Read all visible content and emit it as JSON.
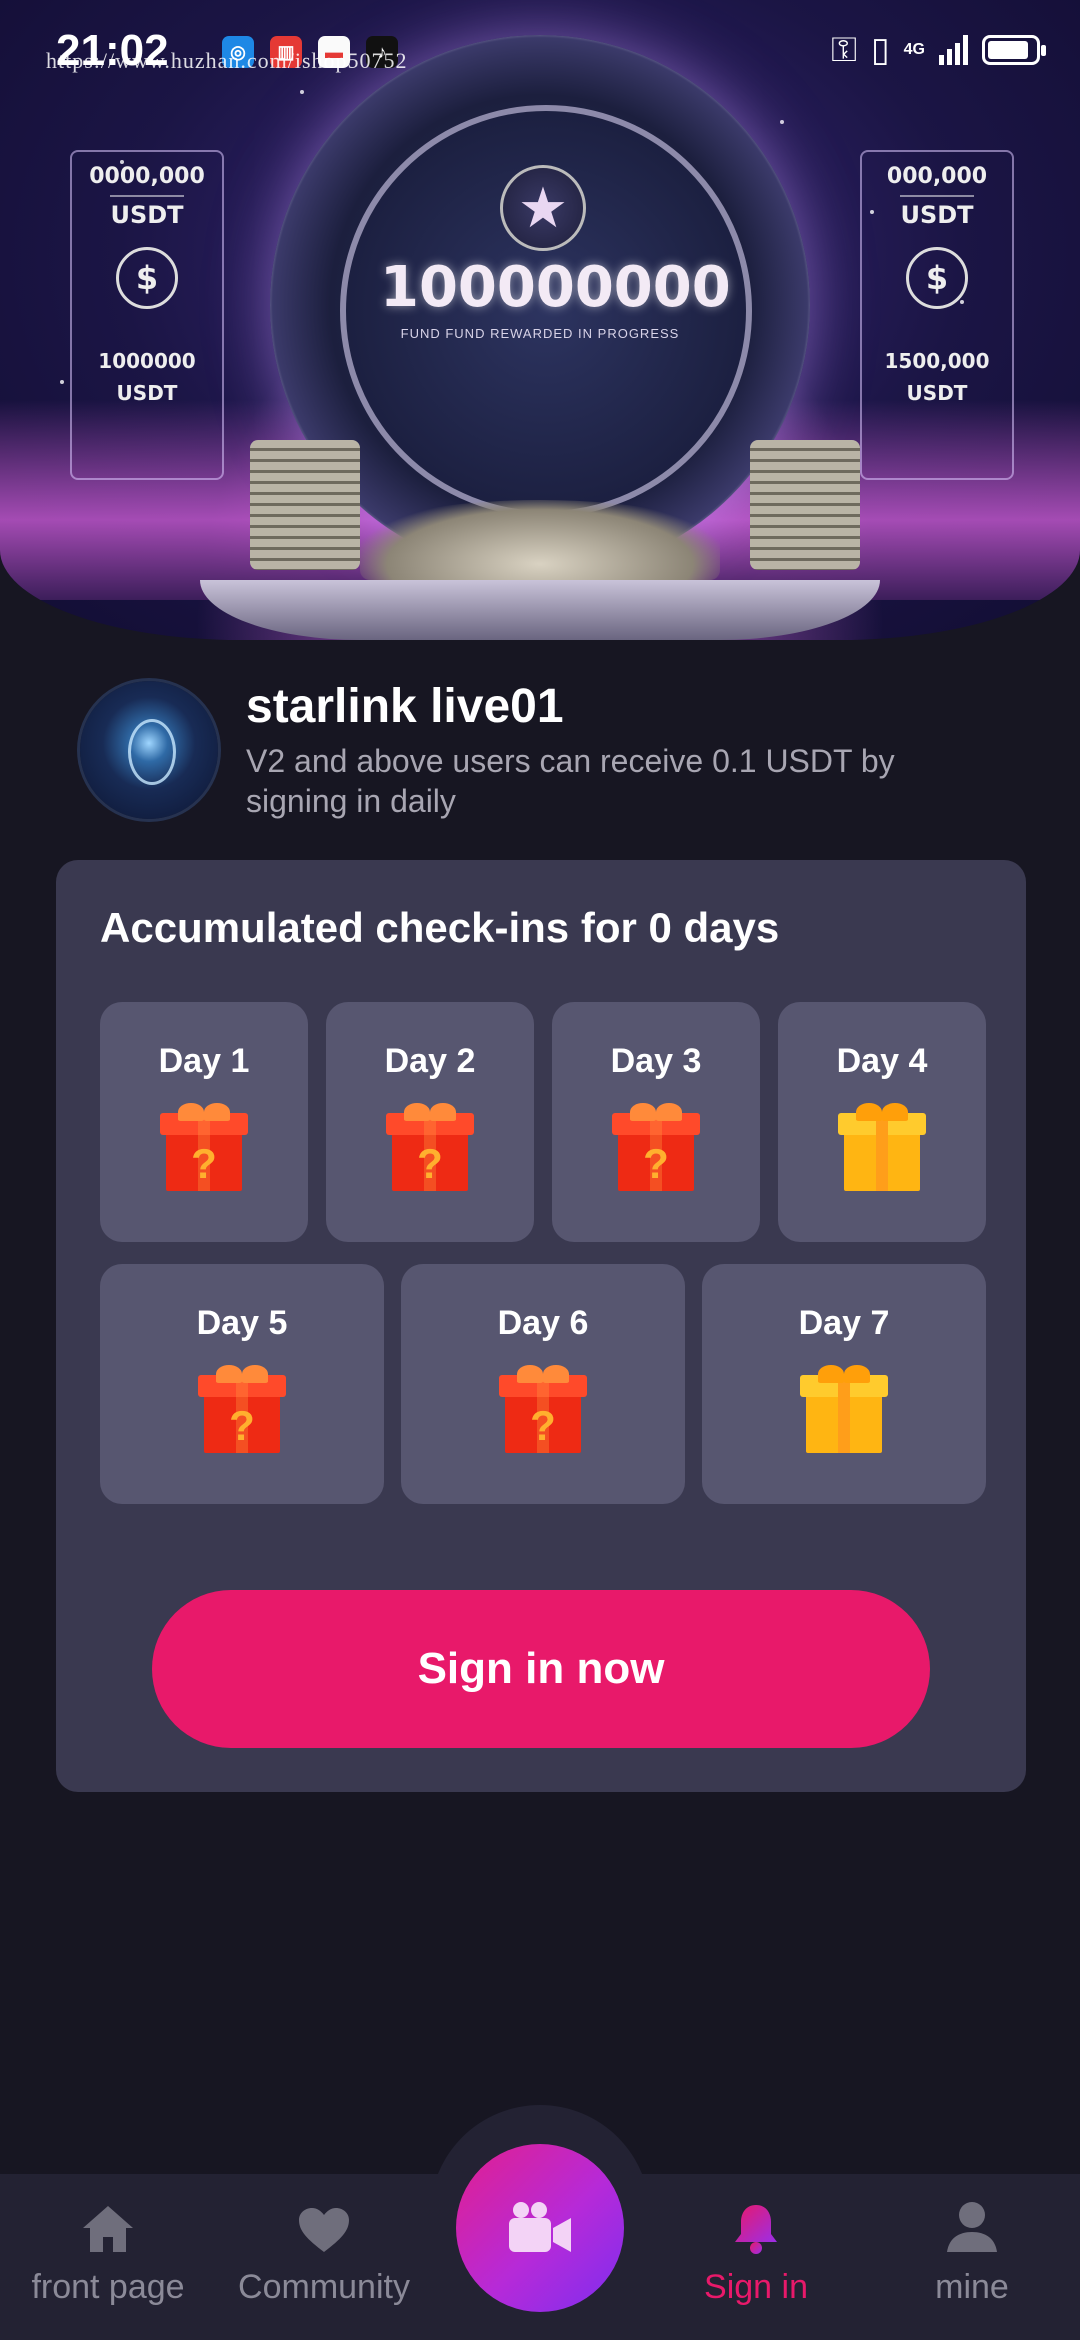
{
  "status_bar": {
    "time": "21:02",
    "network": "4G",
    "apps": [
      "browser-icon",
      "app-red-icon",
      "app-white-icon",
      "tiktok-icon"
    ],
    "watermark": "https://www.huzhan.com/ishop50752"
  },
  "banner": {
    "big_number": "100000000",
    "tagline": "FUND FUND REWARDED IN PROGRESS",
    "left_panel": {
      "amount": "0000,000",
      "unit": "USDT",
      "amount2": "1000000",
      "unit2": "USDT"
    },
    "right_panel": {
      "amount": "000,000",
      "unit": "USDT",
      "amount2": "1500,000",
      "unit2": "USDT"
    },
    "colors": {
      "top": "#120d33",
      "glow": "#d06ad9"
    }
  },
  "profile": {
    "name": "starlink live01",
    "description": "V2 and above users can receive 0.1 USDT by signing in daily"
  },
  "checkin": {
    "title": "Accumulated check-ins for 0 days",
    "days": [
      {
        "label": "Day 1",
        "gift": "mystery-gift-red"
      },
      {
        "label": "Day 2",
        "gift": "mystery-gift-red"
      },
      {
        "label": "Day 3",
        "gift": "mystery-gift-red"
      },
      {
        "label": "Day 4",
        "gift": "gift-gold"
      },
      {
        "label": "Day 5",
        "gift": "mystery-gift-red"
      },
      {
        "label": "Day 6",
        "gift": "mystery-gift-red"
      },
      {
        "label": "Day 7",
        "gift": "gift-gold"
      }
    ],
    "button_label": "Sign in now",
    "button_color": "#e8196a"
  },
  "bottom_nav": {
    "items": [
      {
        "label": "front page",
        "icon": "home-icon",
        "active": false
      },
      {
        "label": "Community",
        "icon": "heart-icon",
        "active": false
      },
      {
        "label": "",
        "icon": "video-camera-icon",
        "active": false
      },
      {
        "label": "Sign in",
        "icon": "bell-icon",
        "active": true
      },
      {
        "label": "mine",
        "icon": "user-icon",
        "active": false
      }
    ],
    "active_color": "#e8196a"
  }
}
